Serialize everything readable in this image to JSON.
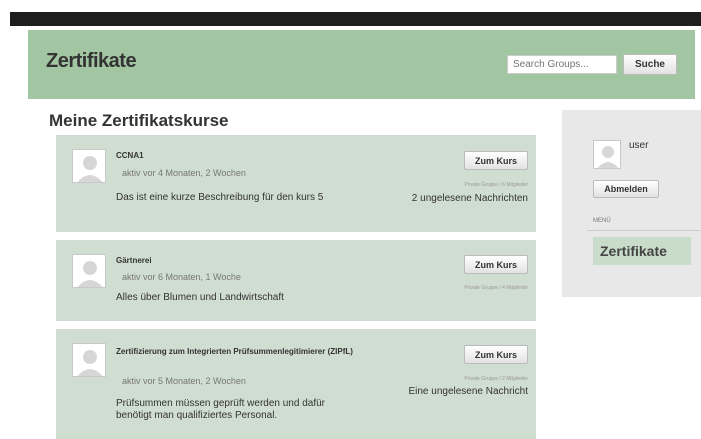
{
  "header": {
    "title": "Zertifikate",
    "search_placeholder": "Search Groups...",
    "search_button": "Suche"
  },
  "main": {
    "section_title": "Meine Zertifikatskurse",
    "courses": [
      {
        "title": "CCNA1",
        "meta": "aktiv vor 4 Monaten, 2 Wochen",
        "description": "Das ist eine kurze Beschreibung für den kurs 5",
        "button": "Zum Kurs",
        "group_info": "Private Gruppe / 6 Mitglieder",
        "unread": "2 ungelesene Nachrichten"
      },
      {
        "title": "Gärtnerei",
        "meta": "aktiv vor 6 Monaten, 1 Woche",
        "description": "Alles über Blumen und Landwirtschaft",
        "button": "Zum Kurs",
        "group_info": "Private Gruppe / 4 Mitglieder"
      },
      {
        "title": "Zertifizierung zum Integrierten Prüfsummenlegitimierer (ZIPfL)",
        "meta": "aktiv vor 5 Monaten, 2 Wochen",
        "description": "Prüfsummen müssen geprüft werden und dafür benötigt man qualifiziertes Personal.",
        "button": "Zum Kurs",
        "group_info": "Private Gruppe / 2 Mitglieder",
        "unread": "Eine ungelesene Nachricht"
      }
    ]
  },
  "sidebar": {
    "username": "user",
    "logout_button": "Abmelden",
    "menu_label": "MENÜ",
    "menu_items": [
      "Zertifikate"
    ]
  },
  "icons": {
    "avatar": "user-avatar-icon"
  },
  "colors": {
    "header_bg": "#a2c6a2",
    "card_bg": "#d0ddd1",
    "sidebar_bg": "#e8e8e8",
    "menu_item_bg": "#c9dcc9"
  }
}
